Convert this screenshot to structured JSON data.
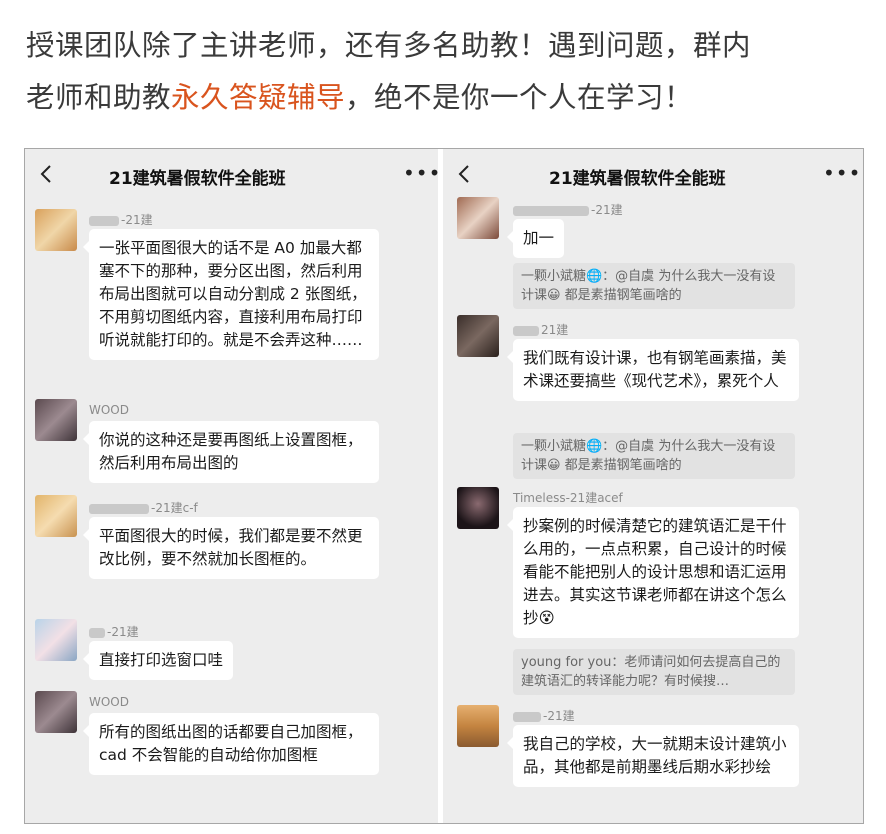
{
  "headline": {
    "line1": "授课团队除了主讲老师，还有多名助教！遇到问题，群内",
    "line2_pre": "老师和助教",
    "line2_highlight": "永久答疑辅导",
    "line2_post": "，绝不是你一个人在学习！",
    "highlight_color": "#d9541e"
  },
  "left_chat": {
    "title": "21建筑暑假软件全能班",
    "back_icon": "chevron-left-icon",
    "more_icon": "ellipsis-icon",
    "messages": [
      {
        "sender": "-21建",
        "text": "一张平面图很大的话不是 A0 加最大都塞不下的那种，要分区出图，然后利用布局出图就可以自动分割成 2 张图纸，不用剪切图纸内容，直接利用布局打印听说就能打印的。就是不会弄这种……"
      },
      {
        "sender": "WOOD",
        "text": "你说的这种还是要再图纸上设置图框，然后利用布局出图的"
      },
      {
        "sender": "-21建c-f",
        "text": "平面图很大的时候，我们都是要不然更改比例，要不然就加长图框的。"
      },
      {
        "sender": "-21建",
        "text": "直接打印选窗口哇"
      },
      {
        "sender": "WOOD",
        "text": "所有的图纸出图的话都要自己加图框，cad 不会智能的自动给你加图框"
      }
    ]
  },
  "right_chat": {
    "title": "21建筑暑假软件全能班",
    "back_icon": "chevron-left-icon",
    "more_icon": "ellipsis-icon",
    "messages": [
      {
        "sender": "-21建",
        "text": "加一"
      },
      {
        "quote": "一颗小斌糖🌐：@自虞 为什么我大一没有设计课😀 都是素描钢笔画啥的"
      },
      {
        "sender": "21建",
        "text": "我们既有设计课，也有钢笔画素描，美术课还要搞些《现代艺术》，累死个人"
      },
      {
        "quote": "一颗小斌糖🌐：@自虞 为什么我大一没有设计课😀 都是素描钢笔画啥的"
      },
      {
        "sender": "Timeless-21建acef",
        "text": "抄案例的时候清楚它的建筑语汇是干什么用的，一点点积累，自己设计的时候看能不能把别人的设计思想和语汇运用进去。其实这节课老师都在讲这个怎么抄😵"
      },
      {
        "quote": "young for you：老师请问如何去提高自己的建筑语汇的转译能力呢？有时候搜…"
      },
      {
        "sender": "-21建",
        "text": "我自己的学校，大一就期末设计建筑小品，其他都是前期墨线后期水彩抄绘"
      }
    ]
  }
}
